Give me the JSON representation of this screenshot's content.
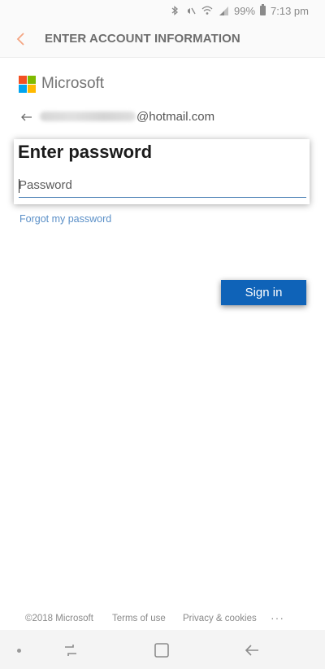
{
  "status_bar": {
    "battery": "99%",
    "time": "7:13 pm"
  },
  "app_bar": {
    "title": "ENTER ACCOUNT INFORMATION",
    "accent_color": "#f4a582"
  },
  "brand": {
    "name": "Microsoft",
    "logo_colors": [
      "#f25022",
      "#7fba00",
      "#00a4ef",
      "#ffb900"
    ]
  },
  "account": {
    "email_domain": "@hotmail.com"
  },
  "password_card": {
    "title": "Enter password",
    "input_value": "",
    "input_placeholder": "Password"
  },
  "links": {
    "forgot_password": "Forgot my password"
  },
  "actions": {
    "sign_in": "Sign in",
    "sign_in_color": "#0f63b8"
  },
  "footer": {
    "copyright": "©2018 Microsoft",
    "terms": "Terms of use",
    "privacy": "Privacy & cookies",
    "more": "···"
  }
}
